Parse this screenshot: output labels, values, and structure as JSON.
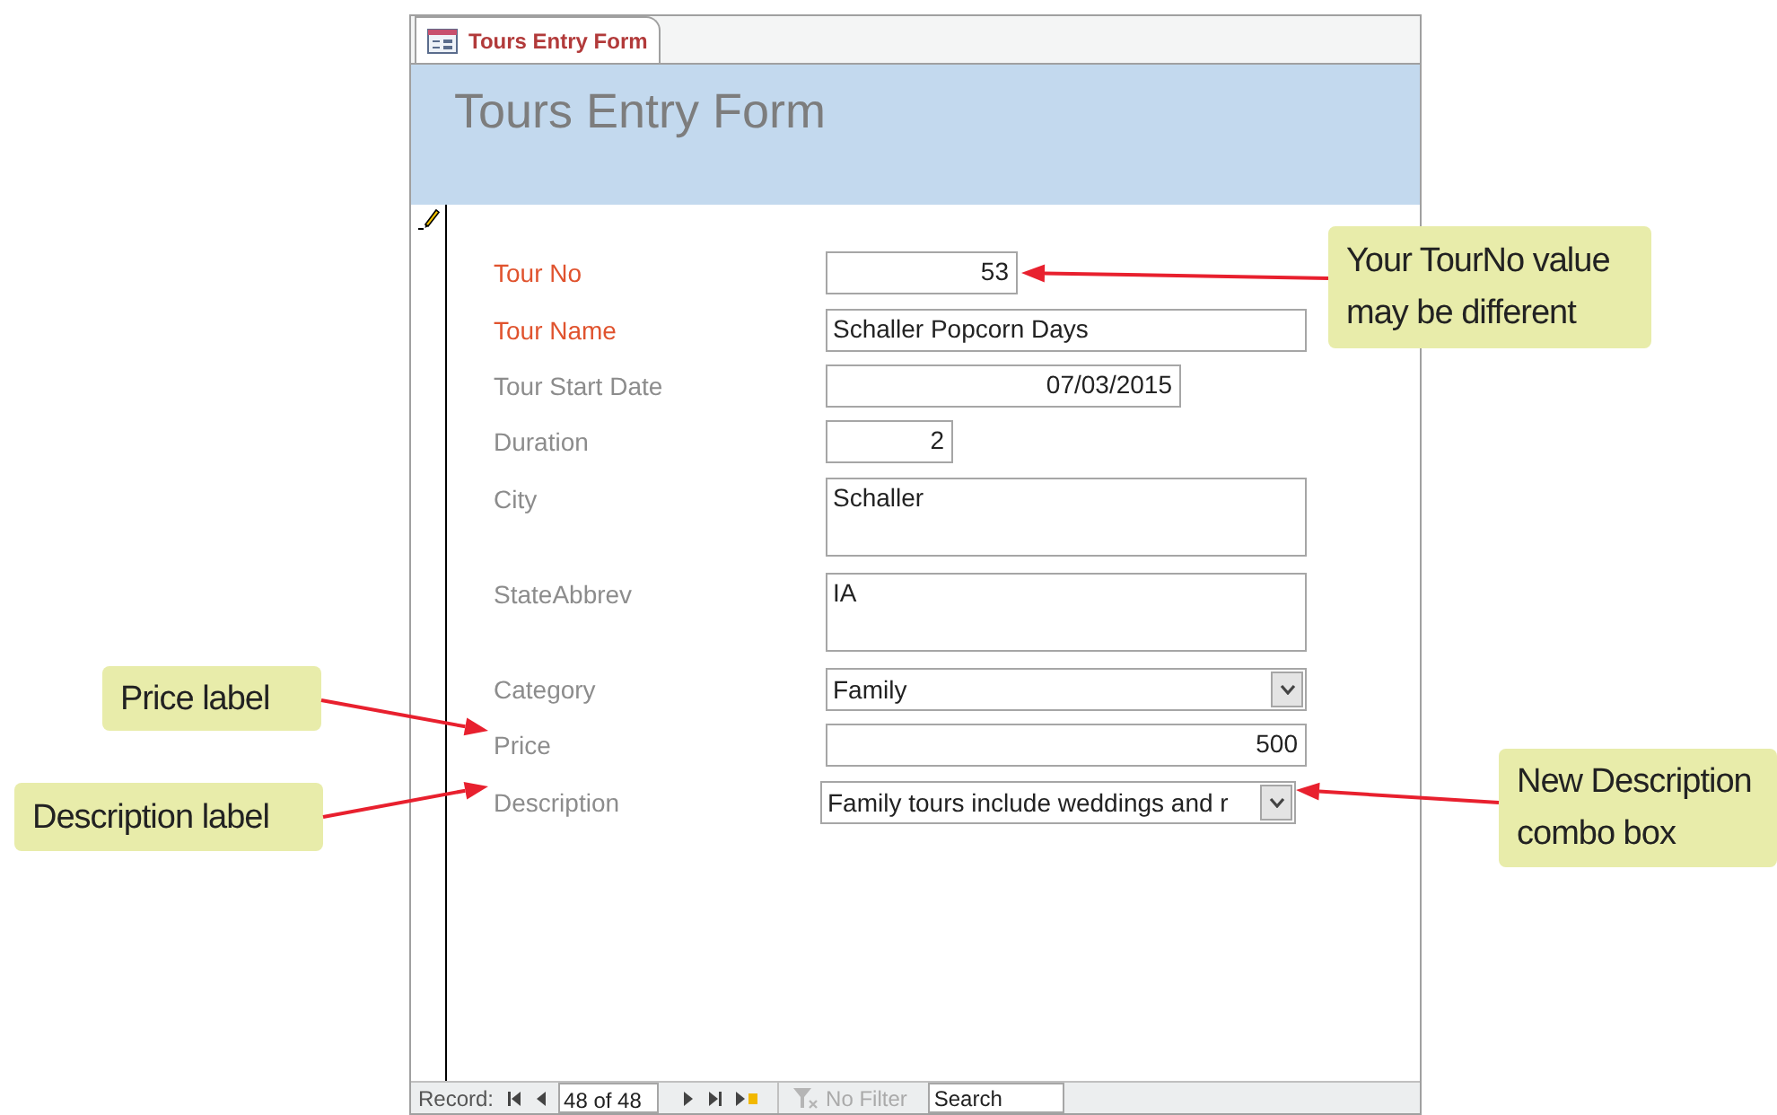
{
  "tab": {
    "label": "Tours Entry Form"
  },
  "header": {
    "title": "Tours Entry Form"
  },
  "fields": [
    {
      "label": "Tour No",
      "highlighted": true,
      "kind": "number",
      "value": "53"
    },
    {
      "label": "Tour Name",
      "highlighted": true,
      "kind": "text",
      "value": "Schaller Popcorn Days"
    },
    {
      "label": "Tour Start Date",
      "highlighted": false,
      "kind": "number",
      "value": "07/03/2015"
    },
    {
      "label": "Duration",
      "highlighted": false,
      "kind": "number",
      "value": "2"
    },
    {
      "label": "City",
      "highlighted": false,
      "kind": "memo",
      "value": "Schaller"
    },
    {
      "label": "StateAbbrev",
      "highlighted": false,
      "kind": "memo",
      "value": "IA"
    },
    {
      "label": "Category",
      "highlighted": false,
      "kind": "combo",
      "value": "Family"
    },
    {
      "label": "Price",
      "highlighted": false,
      "kind": "number",
      "value": "500"
    },
    {
      "label": "Description",
      "highlighted": false,
      "kind": "combo",
      "value": "Family tours include weddings and r"
    }
  ],
  "navigation": {
    "label": "Record:",
    "position": "48 of 48",
    "filter": {
      "label": "No Filter",
      "disabled": true
    },
    "search": {
      "placeholder": "Search"
    }
  },
  "callouts": [
    {
      "lines": [
        "Your TourNo value",
        "may be different"
      ]
    },
    {
      "lines": [
        "Price label"
      ]
    },
    {
      "lines": [
        "Description label"
      ]
    },
    {
      "lines": [
        "New Description",
        "combo box"
      ]
    }
  ]
}
